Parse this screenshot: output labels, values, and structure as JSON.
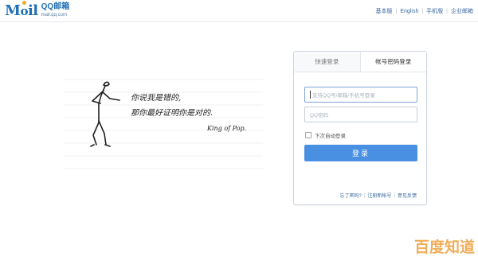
{
  "header": {
    "logo_text": "Mail",
    "logo_name": "QQ邮箱",
    "logo_domain": "mail.qq.com",
    "nav": [
      "基本版",
      "English",
      "手机版",
      "企业邮箱"
    ]
  },
  "art": {
    "line1": "你说我是错的,",
    "line2": "那你最好证明你是对的.",
    "signature": "King of Pop."
  },
  "login": {
    "tabs": [
      "快速登录",
      "帐号密码登录"
    ],
    "active_tab": "帐号密码登录",
    "account_placeholder": "支持QQ号/邮箱/手机号登录",
    "password_placeholder": "QQ密码",
    "remember_label": "下次自动登录",
    "submit_label": "登录",
    "links": [
      "忘了密码?",
      "注册新帐号",
      "意见反馈"
    ]
  },
  "colors": {
    "brand": "#1f6fb5",
    "button": "#4a90e2",
    "link": "#3b6aa0",
    "watermark": "#f0a64a"
  },
  "watermark": "百度知道"
}
